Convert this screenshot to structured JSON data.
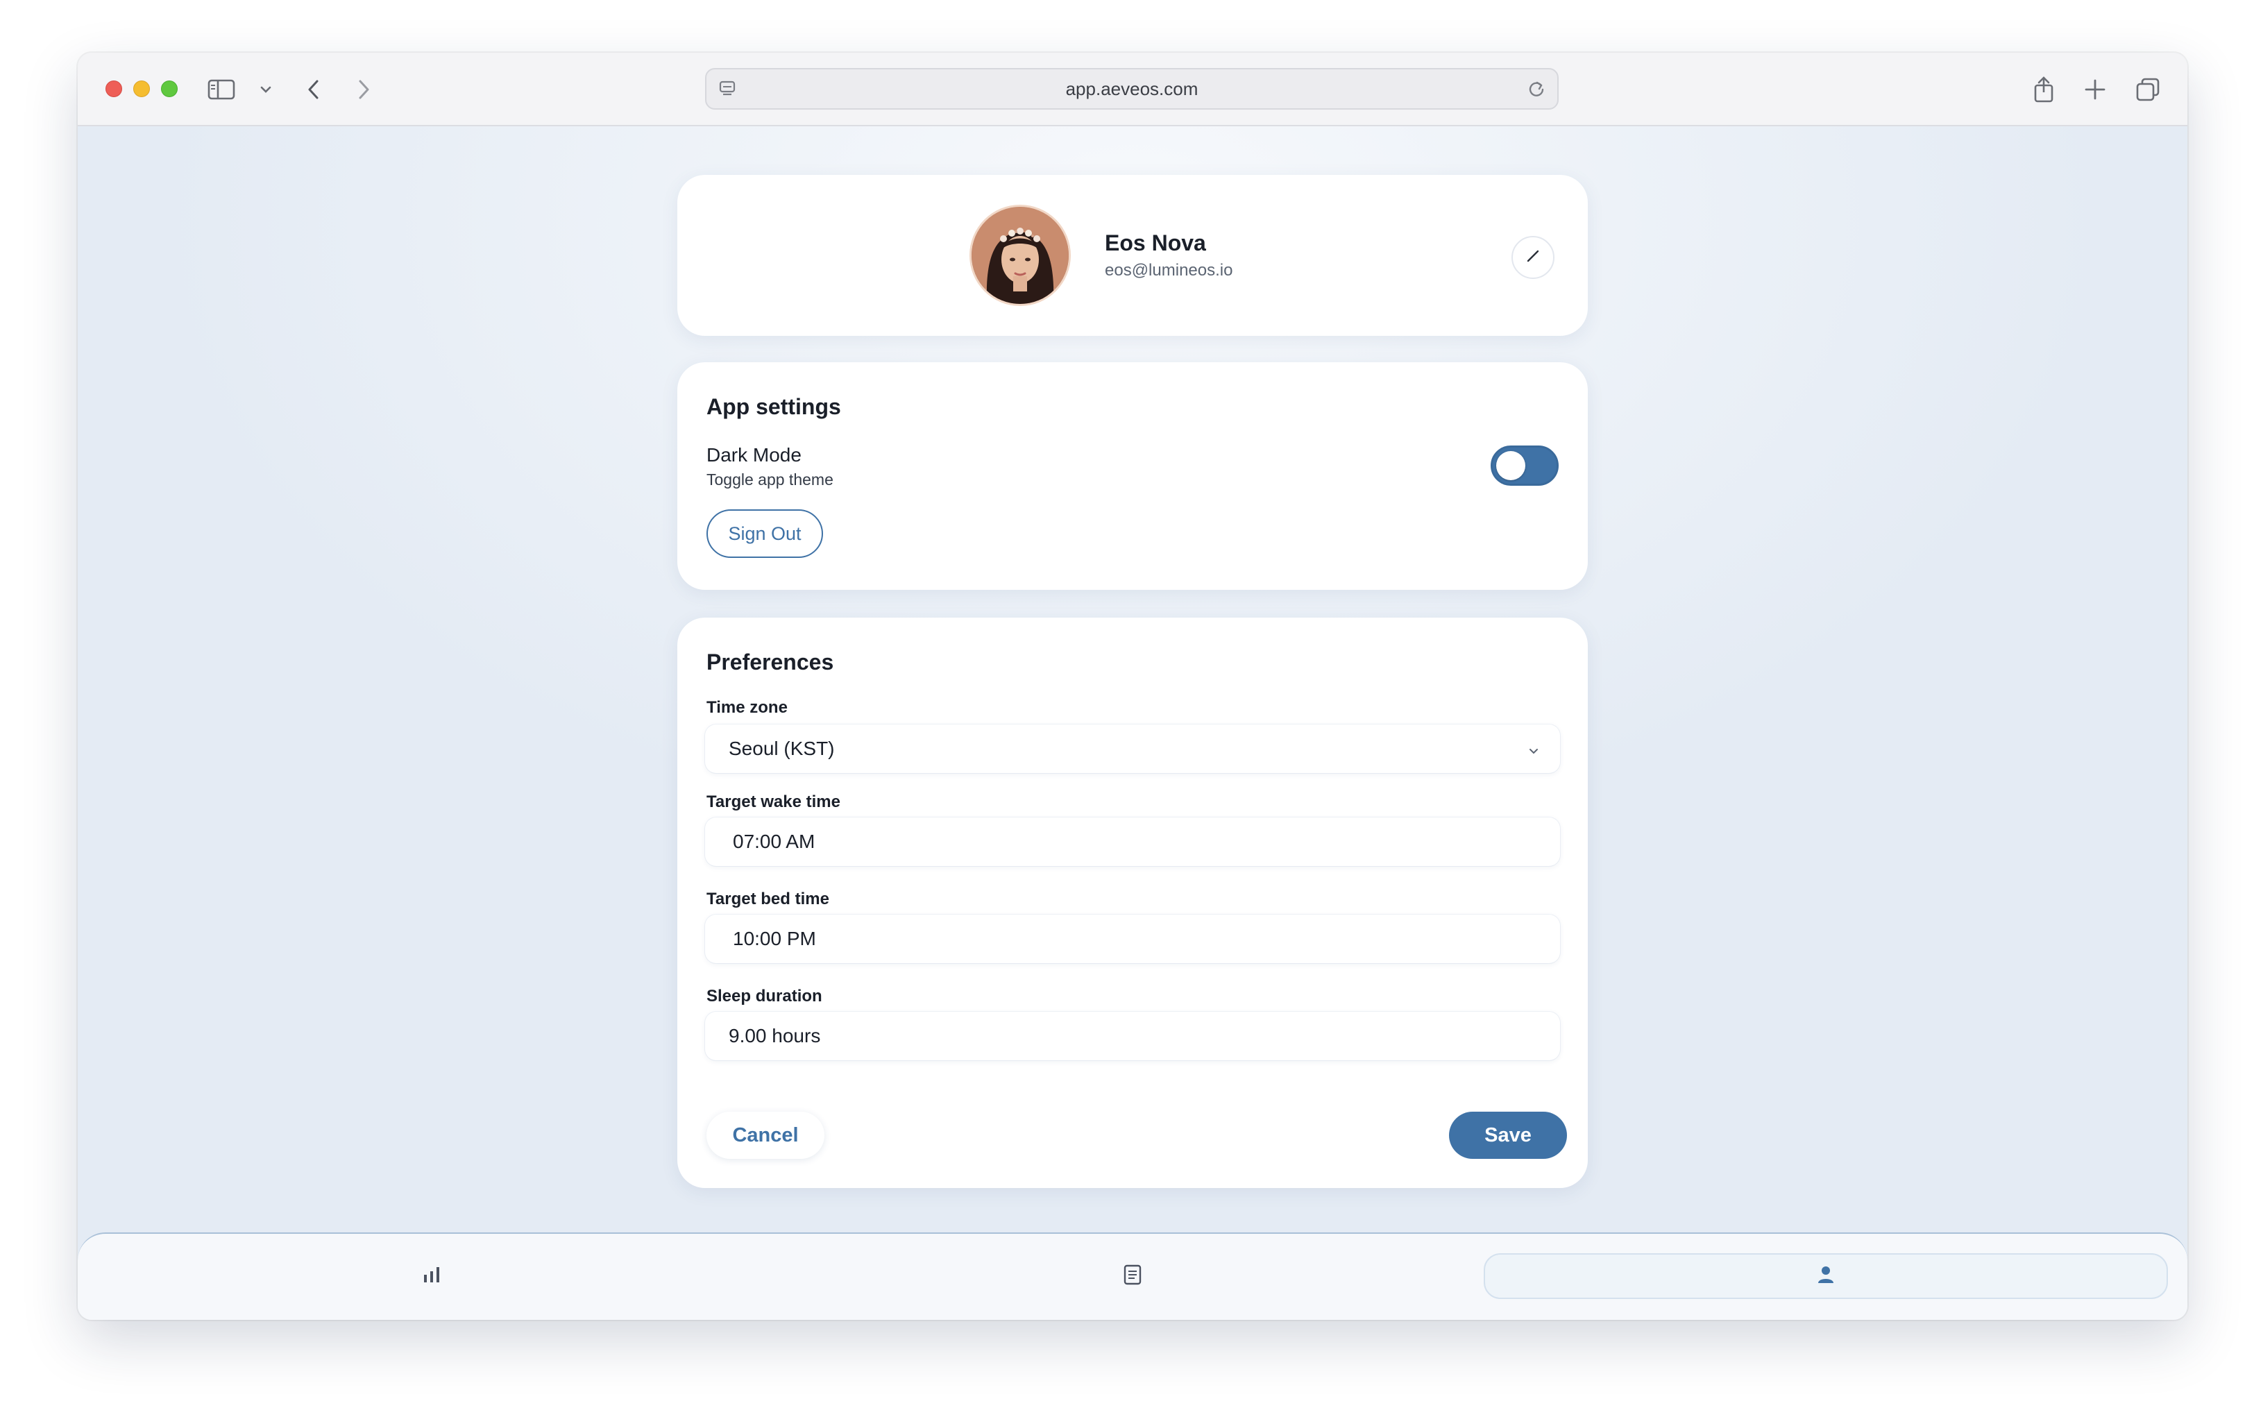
{
  "browser": {
    "url": "app.aeveos.com"
  },
  "profile": {
    "name": "Eos Nova",
    "email": "eos@lumineos.io"
  },
  "app_settings": {
    "title": "App settings",
    "dark_mode_label": "Dark Mode",
    "dark_mode_description": "Toggle app theme",
    "dark_mode_on": false,
    "sign_out_label": "Sign Out"
  },
  "preferences": {
    "title": "Preferences",
    "time_zone_label": "Time zone",
    "time_zone_value": "Seoul (KST)",
    "wake_label": "Target wake time",
    "wake_value": "07:00 AM",
    "bed_label": "Target bed time",
    "bed_value": "10:00 PM",
    "duration_label": "Sleep duration",
    "duration_value": "9.00 hours",
    "cancel_label": "Cancel",
    "save_label": "Save"
  },
  "bottom_nav": {
    "items": [
      {
        "icon": "bar-chart-icon",
        "active": false
      },
      {
        "icon": "document-icon",
        "active": false
      },
      {
        "icon": "person-icon",
        "active": true
      }
    ]
  },
  "colors": {
    "accent": "#3f72a6",
    "background": "#e8eef6",
    "card": "#ffffff"
  }
}
